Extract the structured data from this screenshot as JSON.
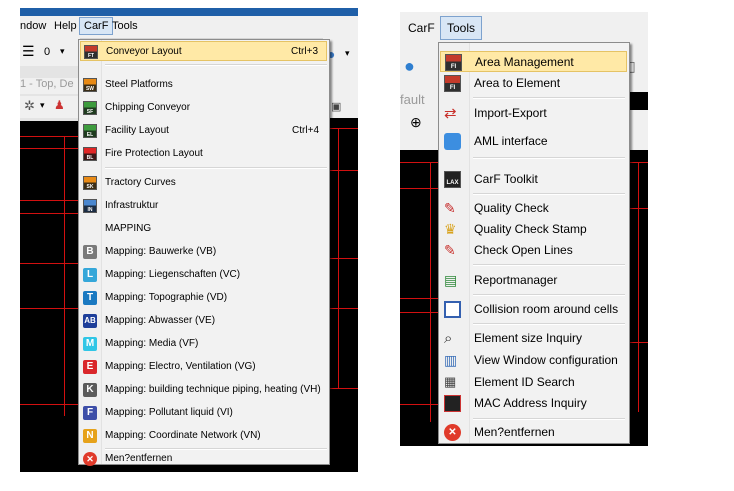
{
  "left": {
    "menubar": {
      "window": "ndow",
      "help": "Help",
      "carf": "CarF",
      "tools": "Tools"
    },
    "toolbar_value": "0",
    "title_fragment": "1 - Top, De",
    "menu_items": [
      {
        "label": "Conveyor Layout",
        "shortcut": "Ctrl+3",
        "icon": "conveyor-icon"
      },
      {
        "label": "Steel Platforms",
        "shortcut": "",
        "icon": "steel-platform-icon"
      },
      {
        "label": "Chipping Conveyor",
        "shortcut": "",
        "icon": "chipping-conveyor-icon"
      },
      {
        "label": "Facility Layout",
        "shortcut": "Ctrl+4",
        "icon": "facility-layout-icon"
      },
      {
        "label": "Fire Protection Layout",
        "shortcut": "",
        "icon": "fire-protection-icon"
      },
      {
        "label": "Tractory Curves",
        "shortcut": "",
        "icon": "tractory-curves-icon"
      },
      {
        "label": "Infrastruktur",
        "shortcut": "",
        "icon": "infrastruktur-icon"
      },
      {
        "label": "MAPPING",
        "shortcut": "",
        "icon": ""
      },
      {
        "label": "Mapping: Bauwerke (VB)",
        "badge": "B",
        "color": "#7a7a7a"
      },
      {
        "label": "Mapping: Liegenschaften (VC)",
        "badge": "L",
        "color": "#35a7d9"
      },
      {
        "label": "Mapping: Topographie (VD)",
        "badge": "T",
        "color": "#1a79c1"
      },
      {
        "label": "Mapping: Abwasser (VE)",
        "badge": "AB",
        "color": "#1e3f9a"
      },
      {
        "label": "Mapping: Media (VF)",
        "badge": "M",
        "color": "#30c6e6"
      },
      {
        "label": "Mapping: Electro, Ventilation (VG)",
        "badge": "E",
        "color": "#d9262a"
      },
      {
        "label": "Mapping: building technique piping, heating (VH)",
        "badge": "K",
        "color": "#5b5b5b"
      },
      {
        "label": "Mapping: Pollutant liquid (VI)",
        "badge": "F",
        "color": "#3d4ea8"
      },
      {
        "label": "Mapping: Coordinate Network (VN)",
        "badge": "N",
        "color": "#e6a21a"
      },
      {
        "label": "Men?entfernen",
        "icon": "remove-icon"
      }
    ]
  },
  "right": {
    "menubar": {
      "carf": "CarF",
      "tools": "Tools"
    },
    "fault_text": "fault",
    "menu_items": [
      {
        "label": "Area Management",
        "icon": "area-management-icon"
      },
      {
        "label": "Area to Element",
        "icon": "area-to-element-icon"
      },
      {
        "label": "Import-Export",
        "icon": "import-export-icon"
      },
      {
        "label": "AML interface",
        "icon": "aml-interface-icon"
      },
      {
        "label": "CarF Toolkit",
        "icon": "toolkit-icon",
        "badge": "LAX"
      },
      {
        "label": "Quality Check",
        "icon": "quality-check-icon"
      },
      {
        "label": "Quality Check Stamp",
        "icon": "quality-stamp-icon"
      },
      {
        "label": "Check Open Lines",
        "icon": "open-lines-icon"
      },
      {
        "label": "Reportmanager",
        "icon": "report-manager-icon"
      },
      {
        "label": "Collision room around cells",
        "icon": "collision-room-icon"
      },
      {
        "label": "Element size Inquiry",
        "icon": "magnifier-icon"
      },
      {
        "label": "View Window configuration",
        "icon": "view-window-icon"
      },
      {
        "label": "Element ID Search",
        "icon": "id-search-icon"
      },
      {
        "label": "MAC Address Inquiry",
        "icon": "mac-address-icon"
      },
      {
        "label": "Men?entfernen",
        "icon": "remove-icon"
      }
    ]
  },
  "colors": {
    "highlight": "#ffe9a6",
    "highlight_border": "#e5c365",
    "cad_red": "#d21010"
  }
}
